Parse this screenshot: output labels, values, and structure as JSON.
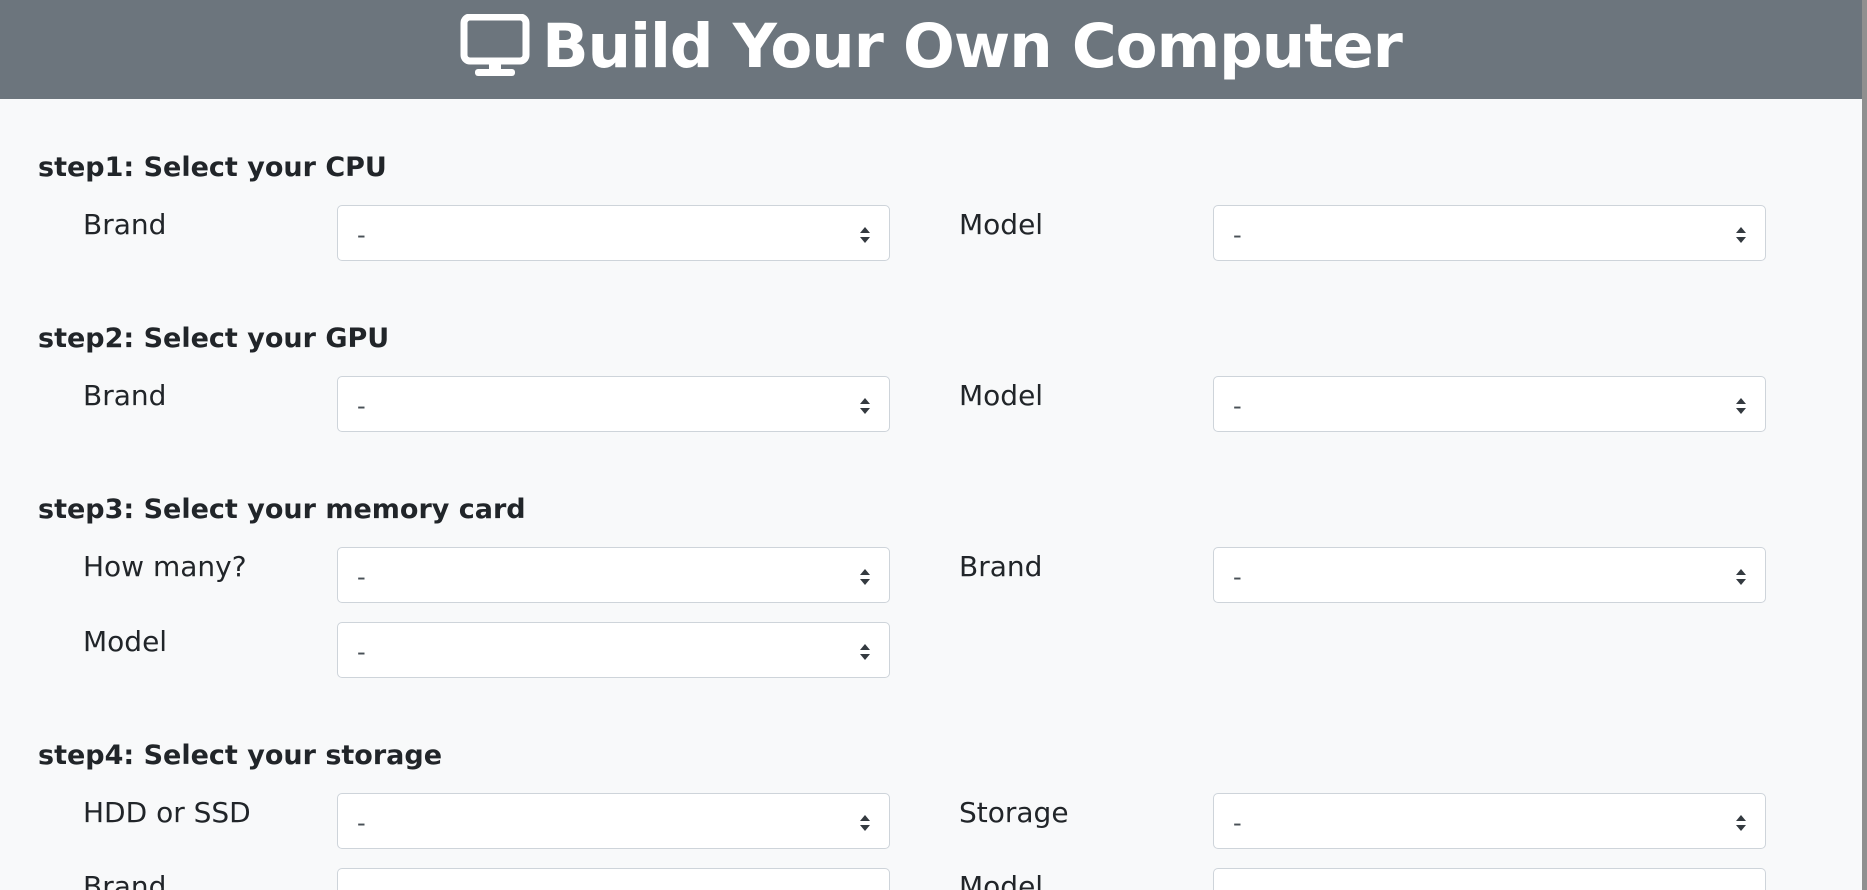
{
  "header": {
    "title": "Build Your Own Computer",
    "icon": "desktop-monitor-icon",
    "background": "#6c757d"
  },
  "steps": [
    {
      "title": "step1: Select your CPU",
      "fields": [
        {
          "label": "Brand",
          "value": "-"
        },
        {
          "label": "Model",
          "value": "-"
        }
      ]
    },
    {
      "title": "step2: Select your GPU",
      "fields": [
        {
          "label": "Brand",
          "value": "-"
        },
        {
          "label": "Model",
          "value": "-"
        }
      ]
    },
    {
      "title": "step3: Select your memory card",
      "fields": [
        {
          "label": "How many?",
          "value": "-"
        },
        {
          "label": "Brand",
          "value": "-"
        },
        {
          "label": "Model",
          "value": "-"
        }
      ]
    },
    {
      "title": "step4: Select your storage",
      "fields": [
        {
          "label": "HDD or SSD",
          "value": "-"
        },
        {
          "label": "Storage",
          "value": "-"
        },
        {
          "label": "Brand",
          "value": ""
        },
        {
          "label": "Model",
          "value": ""
        }
      ]
    }
  ]
}
